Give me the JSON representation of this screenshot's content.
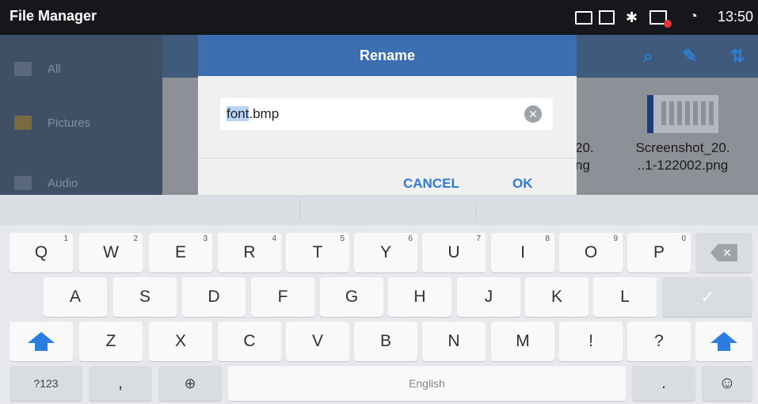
{
  "status_bar": {
    "app_title": "File Manager",
    "time": "13:50",
    "icons": [
      "keyboard-icon",
      "screenshot-icon",
      "bluetooth-icon",
      "network-off-icon",
      "wifi-icon"
    ]
  },
  "drawer": {
    "items": [
      {
        "label": "All",
        "icon": "folder-icon"
      },
      {
        "label": "Pictures",
        "icon": "image-icon"
      },
      {
        "label": "Audio",
        "icon": "music-icon"
      }
    ]
  },
  "toolbar": {
    "icons": [
      "search-icon",
      "edit-icon",
      "sort-icon"
    ]
  },
  "files": [
    {
      "line1": "20.",
      "line2": "ng"
    },
    {
      "line1": "Screenshot_20.",
      "line2": "..1-122002.png"
    }
  ],
  "dialog": {
    "title": "Rename",
    "input_selected": "font",
    "input_rest": ".bmp",
    "cancel_label": "CANCEL",
    "ok_label": "OK"
  },
  "keyboard": {
    "row1": [
      {
        "k": "Q",
        "h": "1"
      },
      {
        "k": "W",
        "h": "2"
      },
      {
        "k": "E",
        "h": "3"
      },
      {
        "k": "R",
        "h": "4"
      },
      {
        "k": "T",
        "h": "5"
      },
      {
        "k": "Y",
        "h": "6"
      },
      {
        "k": "U",
        "h": "7"
      },
      {
        "k": "I",
        "h": "8"
      },
      {
        "k": "O",
        "h": "9"
      },
      {
        "k": "P",
        "h": "0"
      }
    ],
    "row2": [
      "A",
      "S",
      "D",
      "F",
      "G",
      "H",
      "J",
      "K",
      "L"
    ],
    "row3": [
      "Z",
      "X",
      "C",
      "V",
      "B",
      "N",
      "M",
      "!",
      "?"
    ],
    "symbols_label": "?123",
    "comma_label": ",",
    "space_label": "English",
    "period_label": "."
  },
  "colors": {
    "accent": "#3b6fb1",
    "button_text": "#2f7ad7",
    "shift": "#2b7ee0"
  }
}
